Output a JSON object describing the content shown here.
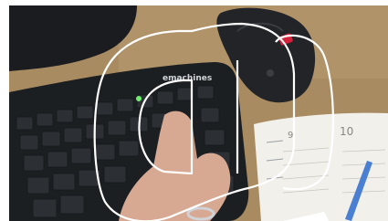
{
  "scene": {
    "keyboard_brand": "emachines",
    "planner_numbers": [
      "9",
      "10"
    ],
    "colors": {
      "desk": "#a98b62",
      "keyboard": "#1c1f22",
      "mouse_accent": "#d6213a",
      "outline_stroke": "#ffffff",
      "pen": "#4b7fd1"
    }
  }
}
